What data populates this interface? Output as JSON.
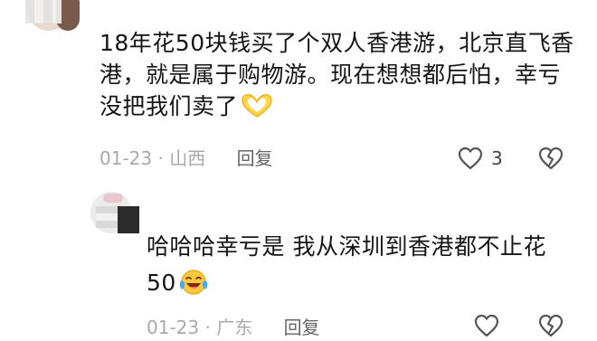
{
  "comments": [
    {
      "text": "18年花50块钱买了个双人香港游，北京直飞香港，就是属于购物游。现在想想都后怕，幸亏没把我们卖了",
      "emoji": "heart-hands-icon",
      "date": "01-23",
      "location": "山西",
      "separator": "·",
      "reply_label": "回复",
      "like_count": "3"
    },
    {
      "text": "哈哈哈幸亏是 我从深圳到香港都不止花50",
      "emoji": "laugh-cry-icon",
      "date": "01-23",
      "location": "广东",
      "separator": "·",
      "reply_label": "回复"
    }
  ],
  "colors": {
    "text": "#151515",
    "meta": "#a9a9a9",
    "reply": "#666666",
    "icon_stroke": "#555555",
    "emoji_yellow": "#ffc83d"
  }
}
